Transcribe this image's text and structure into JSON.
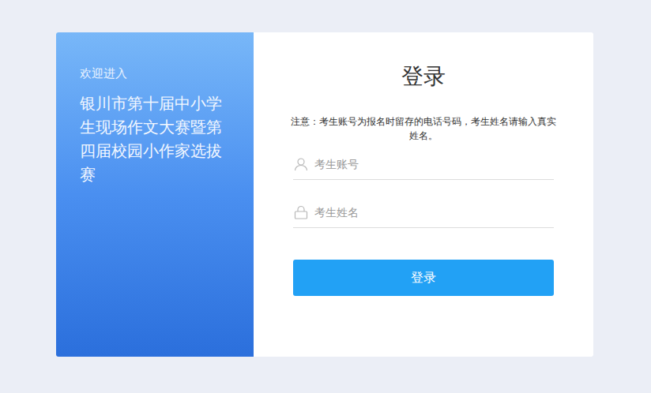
{
  "left": {
    "greeting": "欢迎进入",
    "title": "银川市第十届中小学生现场作文大赛暨第四届校园小作家选拔赛"
  },
  "form": {
    "title": "登录",
    "notice": "注意：考生账号为报名时留存的电话号码，考生姓名请输入真实姓名。",
    "fields": [
      {
        "placeholder": "考生账号",
        "kind": "user"
      },
      {
        "placeholder": "考生姓名",
        "kind": "lock"
      }
    ],
    "button": "登录"
  }
}
